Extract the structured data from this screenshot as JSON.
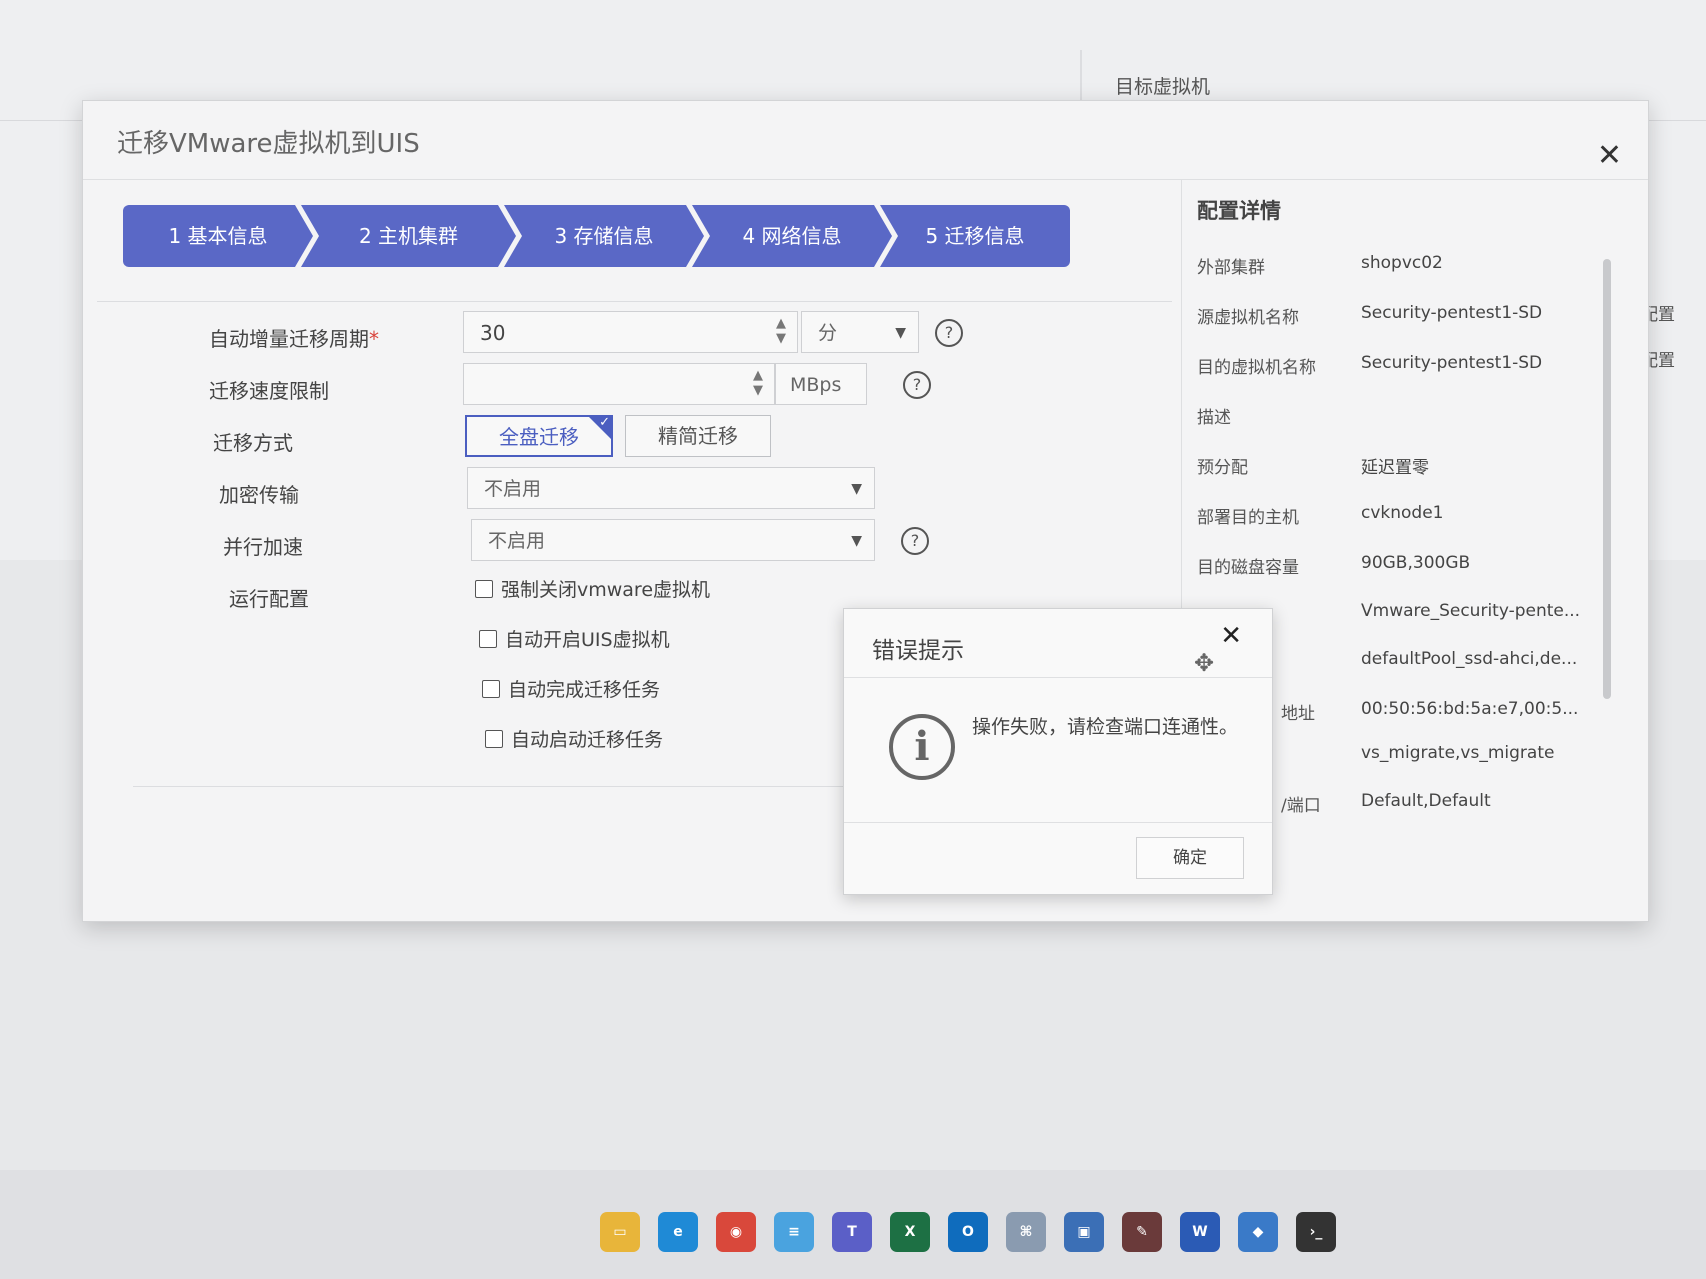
{
  "background": {
    "target_vm_title": "目标虚拟机",
    "legend": [
      {
        "label": "已配置",
        "color": "#3a6de0"
      },
      {
        "label": "未配置",
        "color": "#d9433b"
      }
    ]
  },
  "dialog": {
    "title": "迁移VMware虚拟机到UIS",
    "close_icon": "close-icon",
    "steps": [
      {
        "label": "1 基本信息"
      },
      {
        "label": "2 主机集群"
      },
      {
        "label": "3 存储信息"
      },
      {
        "label": "4 网络信息"
      },
      {
        "label": "5 迁移信息"
      }
    ],
    "accent_color": "#5a68c6",
    "form": {
      "cycle_label": "自动增量迁移周期",
      "cycle_required": "*",
      "cycle_value": "30",
      "cycle_unit": "分",
      "speed_label": "迁移速度限制",
      "speed_value": "",
      "speed_unit": "MBps",
      "mode_label": "迁移方式",
      "mode_full": "全盘迁移",
      "mode_thin": "精简迁移",
      "mode_selected": "全盘迁移",
      "encrypt_label": "加密传输",
      "encrypt_value": "不启用",
      "parallel_label": "并行加速",
      "parallel_value": "不启用",
      "run_label": "运行配置",
      "run_options": [
        {
          "label": "强制关闭vmware虚拟机",
          "checked": false
        },
        {
          "label": "自动开启UIS虚拟机",
          "checked": false
        },
        {
          "label": "自动完成迁移任务",
          "checked": false
        },
        {
          "label": "自动启动迁移任务",
          "checked": false
        }
      ]
    },
    "details": {
      "title": "配置详情",
      "rows": [
        {
          "label": "外部集群",
          "value": "shopvc02"
        },
        {
          "label": "源虚拟机名称",
          "value": "Security-pentest1-SD"
        },
        {
          "label": "目的虚拟机名称",
          "value": "Security-pentest1-SD"
        },
        {
          "label": "描述",
          "value": ""
        },
        {
          "label": "预分配",
          "value": "延迟置零"
        },
        {
          "label": "部署目的主机",
          "value": "cvknode1"
        },
        {
          "label": "目的磁盘容量",
          "value": "90GB,300GB"
        },
        {
          "label": "",
          "value": "Vmware_Security-pente..."
        },
        {
          "label": "",
          "value": "defaultPool_ssd-ahci,de..."
        },
        {
          "label": "地址",
          "value": "00:50:56:bd:5a:e7,00:5..."
        },
        {
          "label": "",
          "value": "vs_migrate,vs_migrate"
        },
        {
          "label": "/端口",
          "value": "Default,Default"
        }
      ]
    }
  },
  "error_modal": {
    "title": "错误提示",
    "message": "操作失败，请检查端口连通性。",
    "ok_label": "确定",
    "icon": "info-icon"
  },
  "taskbar": {
    "icons": [
      {
        "name": "file-explorer-icon",
        "color": "#e8b53a",
        "glyph": "▭"
      },
      {
        "name": "edge-icon",
        "color": "#1f8ad6",
        "glyph": "e"
      },
      {
        "name": "chrome-icon",
        "color": "#d9483b",
        "glyph": "◉"
      },
      {
        "name": "notepad-icon",
        "color": "#4aa3df",
        "glyph": "≡"
      },
      {
        "name": "teams-icon",
        "color": "#5b5fc7",
        "glyph": "T"
      },
      {
        "name": "excel-icon",
        "color": "#1d7044",
        "glyph": "X"
      },
      {
        "name": "outlook-icon",
        "color": "#0f6cbd",
        "glyph": "O"
      },
      {
        "name": "network-icon",
        "color": "#8a9bb0",
        "glyph": "⌘"
      },
      {
        "name": "remote-desktop-icon",
        "color": "#3b6fb6",
        "glyph": "▣"
      },
      {
        "name": "tool-icon",
        "color": "#6a3a3a",
        "glyph": "✎"
      },
      {
        "name": "word-icon",
        "color": "#2b5bb5",
        "glyph": "W"
      },
      {
        "name": "app-cube-icon",
        "color": "#3a7ac8",
        "glyph": "◆"
      },
      {
        "name": "terminal-icon",
        "color": "#333333",
        "glyph": "›_"
      }
    ]
  }
}
